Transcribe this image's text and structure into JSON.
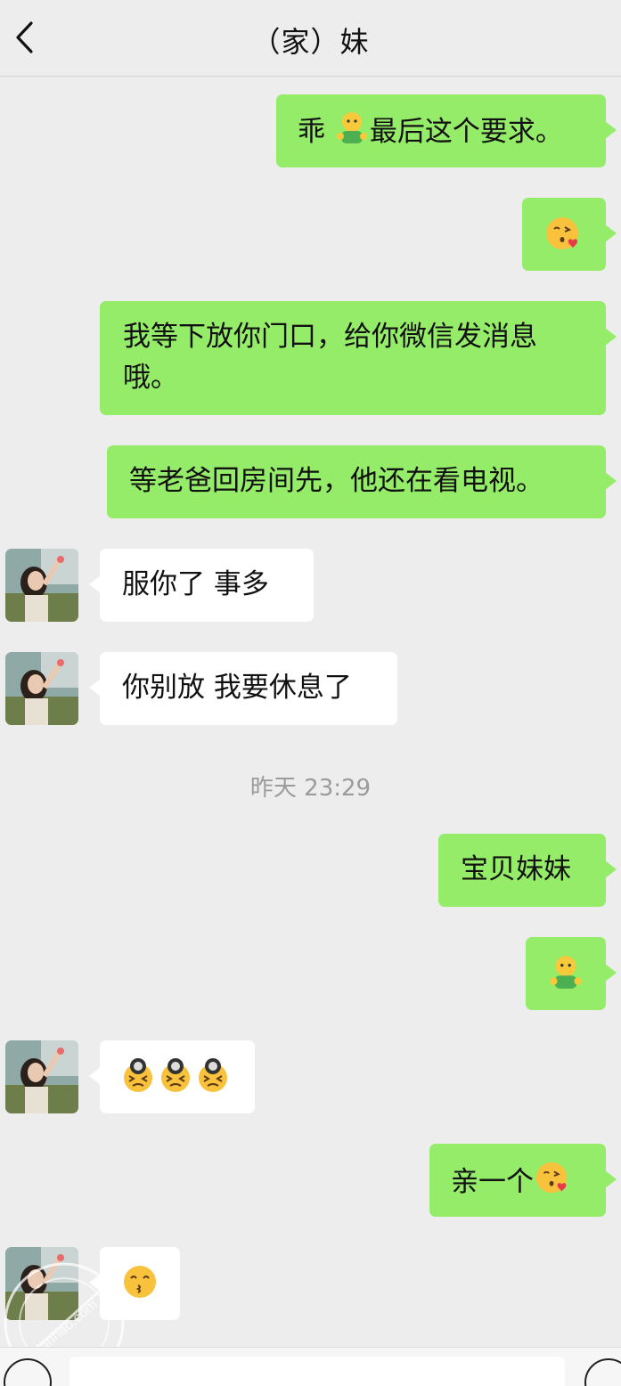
{
  "header": {
    "title": "（家）妹",
    "back_icon": "chevron-left-icon"
  },
  "messages": {
    "m1": {
      "text_before": "乖 ",
      "emoji": "person-with-hands-icon",
      "text_after": "最后这个要求。"
    },
    "m2": {
      "emoji": "face-blowing-kiss-icon"
    },
    "m3": {
      "text": "我等下放你门口，给你微信发消息哦。"
    },
    "m4": {
      "text": "等老爸回房间先，他还在看电视。"
    },
    "m5": {
      "text": "服你了 事多"
    },
    "m6": {
      "text": "你别放 我要休息了"
    },
    "timestamp": "昨天 23:29",
    "m7": {
      "text": "宝贝妹妹"
    },
    "m8": {
      "emoji": "person-with-hands-icon"
    },
    "m9": {
      "emoji": "frustrated-face-icon",
      "count": 3
    },
    "m10": {
      "text": "亲一个",
      "emoji": "face-blowing-kiss-icon"
    },
    "m11": {
      "emoji": "kissing-face-smiling-eyes-icon"
    }
  },
  "watermark": {
    "text": "lanhao.com"
  },
  "colors": {
    "outgoing": "#95ec69",
    "incoming": "#ffffff",
    "background": "#ededed"
  }
}
